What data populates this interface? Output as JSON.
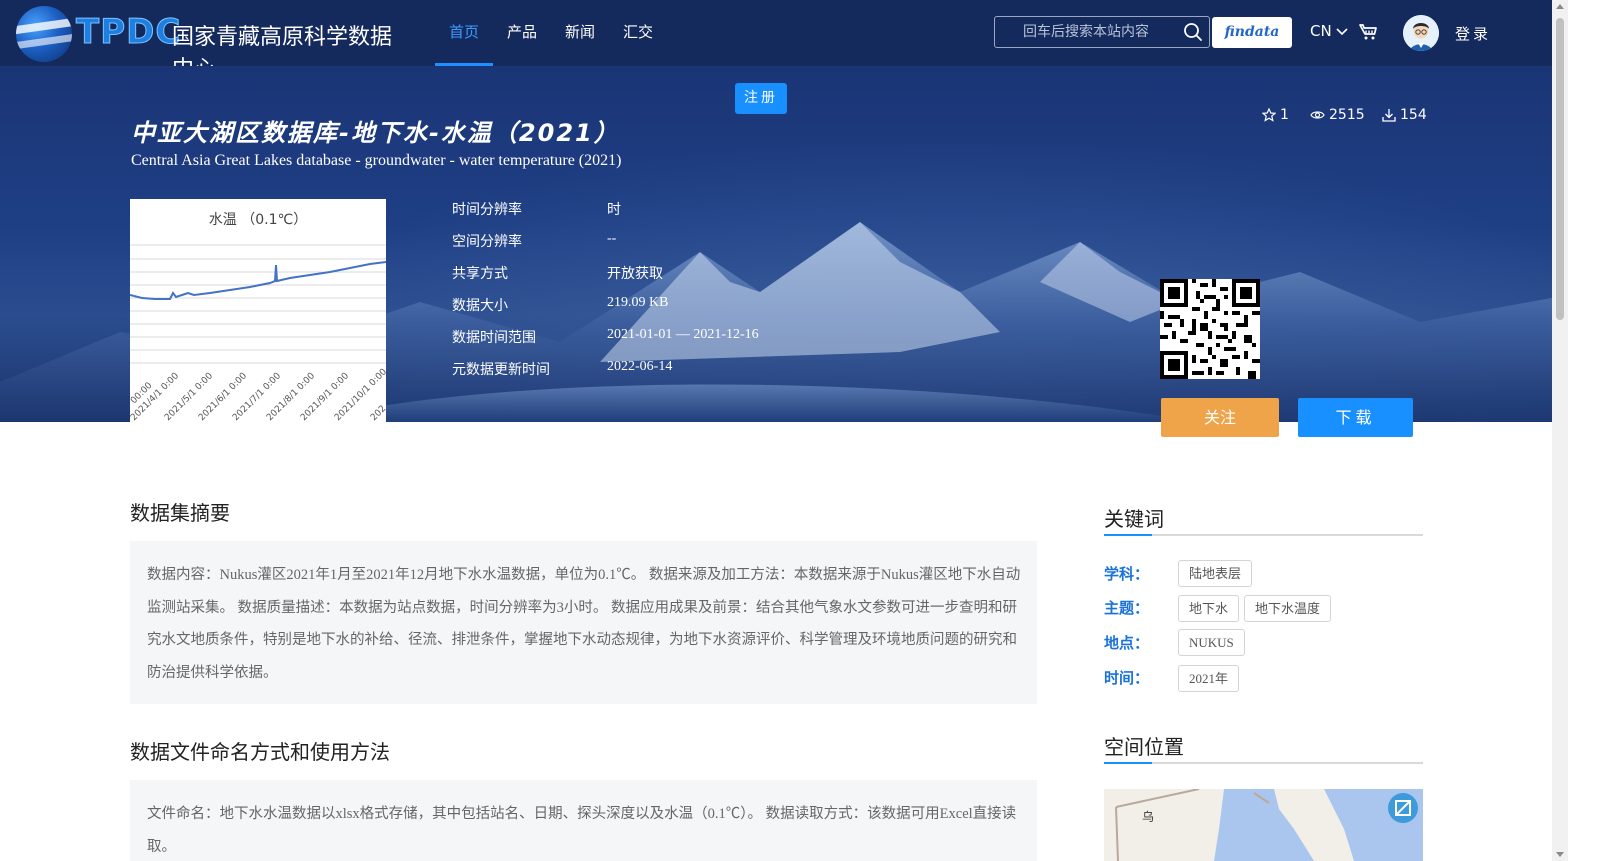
{
  "header": {
    "logo_tpdc": "TPDC",
    "logo_cn": "国家青藏高原科学数据中心",
    "nav": [
      "首页",
      "产品",
      "新闻",
      "汇交"
    ],
    "search_placeholder": "回车后搜索本站内容",
    "findata": "findata",
    "lang": "CN",
    "login": "登录"
  },
  "hero": {
    "register": "注册",
    "title_cn": "中亚大湖区数据库-地下水-水温（2021）",
    "title_en": "Central Asia Great Lakes database - groundwater - water temperature (2021)",
    "stats": {
      "stars": "1",
      "views": "2515",
      "downloads": "154"
    },
    "thumbnail_title": "水温 （0.1℃）",
    "thumbnail_dates": [
      "00:00",
      "2021/4/1 0:00",
      "2021/5/1 0:00",
      "2021/6/1 0:00",
      "2021/7/1 0:00",
      "2021/8/1 0:00",
      "2021/9/1 0:00",
      "2021/10/1 0:00",
      "202"
    ],
    "meta": [
      {
        "label": "时间分辨率",
        "value": "时"
      },
      {
        "label": "空间分辨率",
        "value": "--"
      },
      {
        "label": "共享方式",
        "value": "开放获取"
      },
      {
        "label": "数据大小",
        "value": "219.09 KB"
      },
      {
        "label": "数据时间范围",
        "value": "2021-01-01 — 2021-12-16"
      },
      {
        "label": "元数据更新时间",
        "value": "2022-06-14"
      }
    ],
    "follow": "关注",
    "download": "下载"
  },
  "main": {
    "abstract_title": "数据集摘要",
    "abstract_text": "数据内容：Nukus灌区2021年1月至2021年12月地下水水温数据，单位为0.1℃。 数据来源及加工方法：本数据来源于Nukus灌区地下水自动监测站采集。 数据质量描述：本数据为站点数据，时间分辨率为3小时。 数据应用成果及前景：结合其他气象水文参数可进一步查明和研究水文地质条件，特别是地下水的补给、径流、排泄条件，掌握地下水动态规律，为地下水资源评价、科学管理及环境地质问题的研究和防治提供科学依据。",
    "naming_title": "数据文件命名方式和使用方法",
    "naming_text": "文件命名：地下水水温数据以xlsx格式存储，其中包括站名、日期、探头深度以及水温（0.1℃）。 数据读取方式：该数据可用Excel直接读取。"
  },
  "sidebar": {
    "keywords_title": "关键词",
    "keywords": [
      {
        "label": "学科：",
        "tags": [
          "陆地表层"
        ]
      },
      {
        "label": "主题：",
        "tags": [
          "地下水",
          "地下水温度"
        ]
      },
      {
        "label": "地点：",
        "tags": [
          "NUKUS"
        ]
      },
      {
        "label": "时间：",
        "tags": [
          "2021年"
        ]
      }
    ],
    "location_title": "空间位置",
    "map_label": "乌"
  },
  "colors": {
    "header_bg": "#152a5c",
    "accent_blue": "#1890ff",
    "follow_orange": "#f0a44a",
    "keyword_label": "#1a73d9"
  }
}
